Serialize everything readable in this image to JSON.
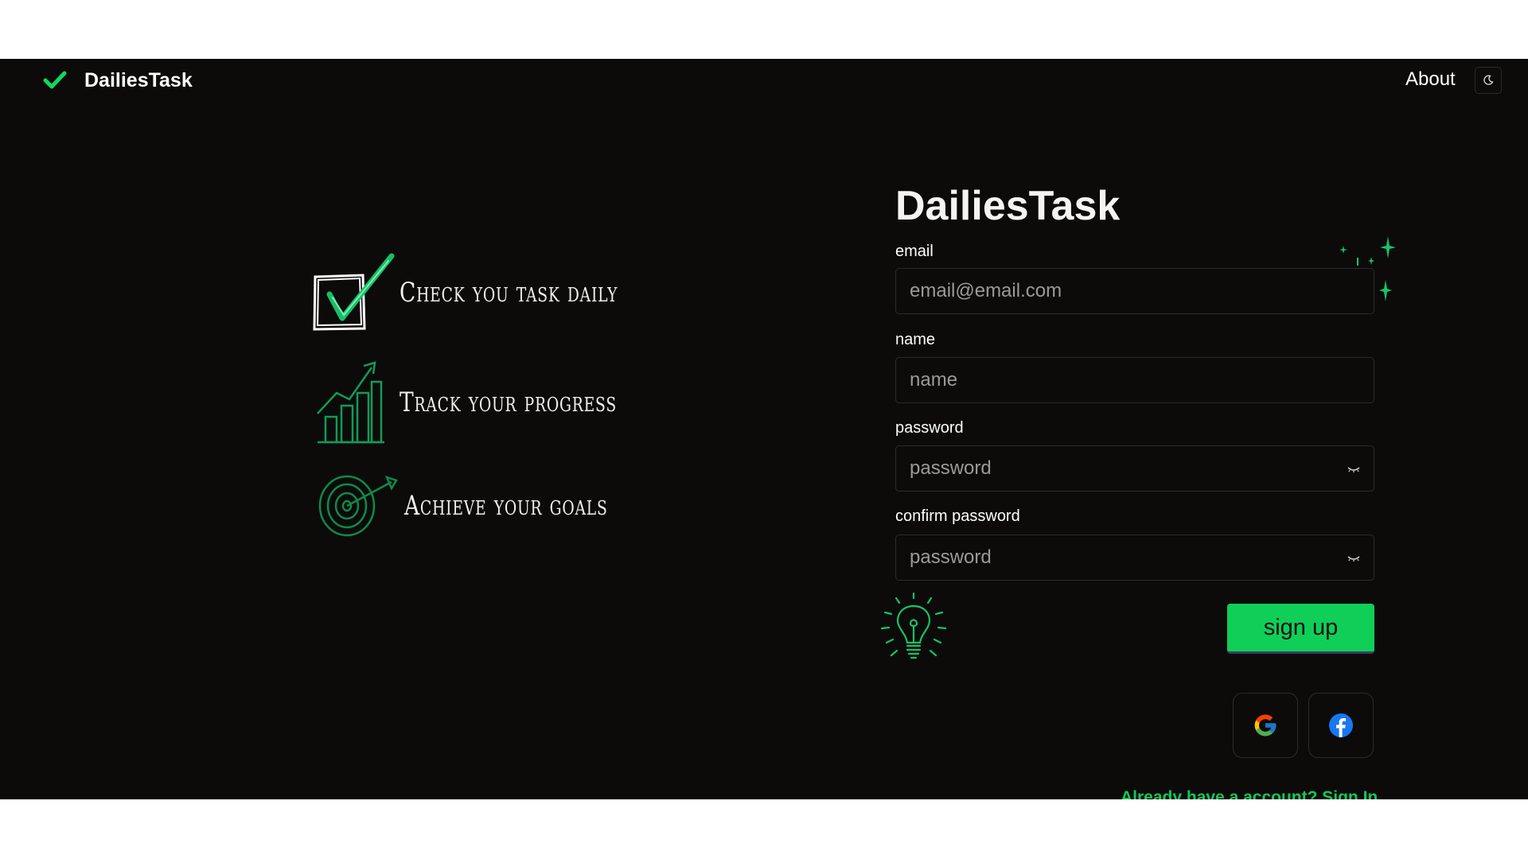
{
  "header": {
    "brand": "DailiesTask",
    "about": "About"
  },
  "features": [
    {
      "text": "Check you task daily",
      "icon": "checkbox-check-icon"
    },
    {
      "text": "Track your progress",
      "icon": "growth-chart-icon"
    },
    {
      "text": "Achieve your goals",
      "icon": "target-dart-icon"
    }
  ],
  "form": {
    "title": "DailiesTask",
    "email_label": "email",
    "email_placeholder": "email@email.com",
    "name_label": "name",
    "name_placeholder": "name",
    "password_label": "password",
    "password_placeholder": "password",
    "confirm_label": "confirm password",
    "confirm_placeholder": "password",
    "submit": "sign up",
    "signin_link": "Already have a account? Sign In"
  },
  "colors": {
    "background": "#0c0b0a",
    "accent": "#0fcf58",
    "link": "#12c85a",
    "facebook": "#1877f2"
  }
}
